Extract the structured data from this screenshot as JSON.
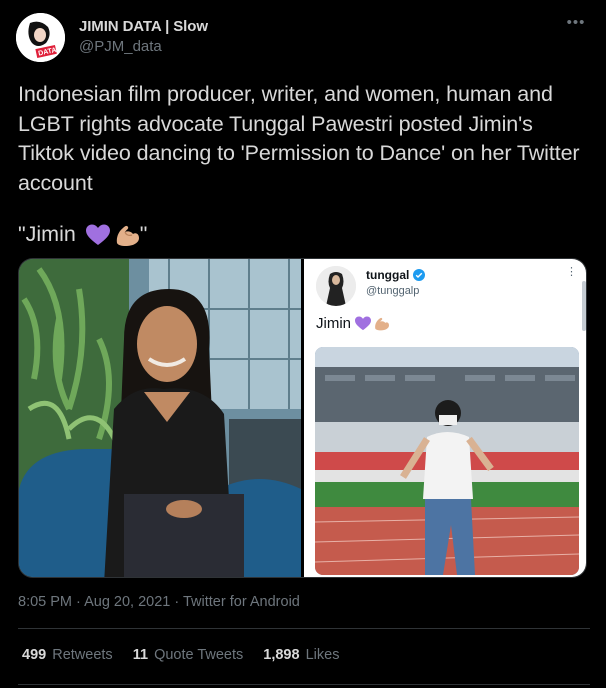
{
  "author": {
    "display_name": "JIMIN DATA | Slow",
    "handle": "@PJM_data",
    "avatar_text": "DATA"
  },
  "more_icon": "more-icon",
  "tweet": {
    "text": "Indonesian film producer, writer, and women, human and LGBT rights advocate Tunggal Pawestri posted Jimin's Tiktok video dancing to 'Permission to Dance' on her Twitter account",
    "quote_open": "\"Jimin ",
    "quote_close": "\"",
    "emojis": [
      "purple-heart-emoji",
      "flexed-biceps-emoji"
    ]
  },
  "embedded": {
    "display_name": "tunggal",
    "handle": "@tunggalp",
    "text": "Jimin "
  },
  "meta": {
    "time": "8:05 PM",
    "sep1": " · ",
    "date": "Aug 20, 2021",
    "sep2": " · ",
    "source": "Twitter for Android"
  },
  "stats": {
    "retweets_count": "499",
    "retweets_label": "Retweets",
    "quotes_count": "11",
    "quotes_label": "Quote Tweets",
    "likes_count": "1,898",
    "likes_label": "Likes"
  },
  "colors": {
    "background": "#000000",
    "text": "#d9d9d9",
    "muted": "#6e767d",
    "border": "#2f3336",
    "purple_heart": "#a070e0",
    "verified": "#1d9bf0"
  }
}
